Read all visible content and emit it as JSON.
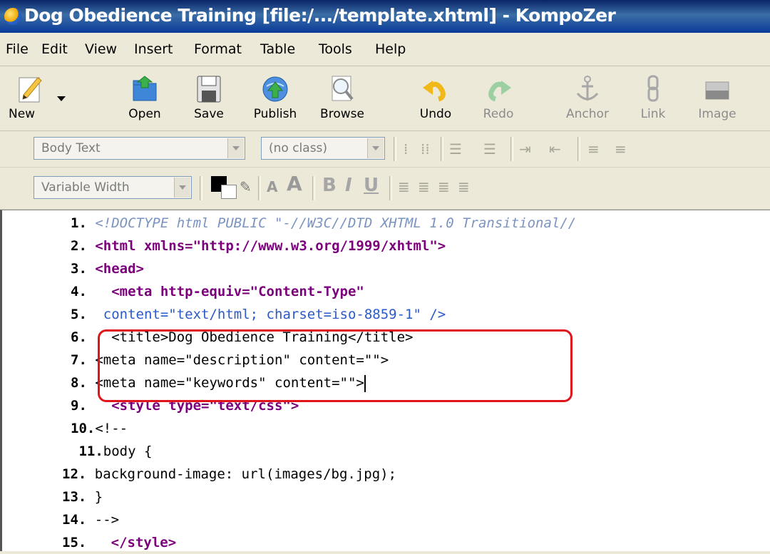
{
  "window": {
    "title": "Dog Obedience Training [file:/.../template.xhtml] - KompoZer"
  },
  "menu": {
    "items": [
      {
        "label": "File"
      },
      {
        "label": "Edit"
      },
      {
        "label": "View"
      },
      {
        "label": "Insert"
      },
      {
        "label": "Format"
      },
      {
        "label": "Table"
      },
      {
        "label": "Tools"
      },
      {
        "label": "Help"
      }
    ]
  },
  "toolbar": {
    "buttons": [
      {
        "label": "New",
        "icon": "new-page-pencil-icon",
        "enabled": true
      },
      {
        "label": "Open",
        "icon": "open-folder-icon",
        "enabled": true
      },
      {
        "label": "Save",
        "icon": "floppy-disk-icon",
        "enabled": true
      },
      {
        "label": "Publish",
        "icon": "globe-upload-icon",
        "enabled": true
      },
      {
        "label": "Browse",
        "icon": "magnifier-page-icon",
        "enabled": true
      },
      {
        "label": "Undo",
        "icon": "undo-arrow-icon",
        "enabled": true
      },
      {
        "label": "Redo",
        "icon": "redo-arrow-icon",
        "enabled": false
      },
      {
        "label": "Anchor",
        "icon": "anchor-icon",
        "enabled": false
      },
      {
        "label": "Link",
        "icon": "chain-link-icon",
        "enabled": false
      },
      {
        "label": "Image",
        "icon": "image-icon",
        "enabled": false
      }
    ]
  },
  "format_toolbar": {
    "paragraph_format": "Body Text",
    "class": "(no class)",
    "font": "Variable Width"
  },
  "editor": {
    "lines": [
      {
        "num": "1.",
        "text": "<!DOCTYPE html PUBLIC \"-//W3C//DTD XHTML 1.0 Transitional//"
      },
      {
        "num": "2.",
        "text": "<html xmlns=\"http://www.w3.org/1999/xhtml\">"
      },
      {
        "num": "3.",
        "text": "<head>"
      },
      {
        "num": "4.",
        "text": "<meta http-equiv=\"Content-Type\""
      },
      {
        "num": "5.",
        "text": "content=\"text/html; charset=iso-8859-1\" />"
      },
      {
        "num": "6.",
        "text": "<title>Dog Obedience Training</title>"
      },
      {
        "num": "7.",
        "text": "<meta name=\"description\" content=\"\">"
      },
      {
        "num": "8.",
        "text": "<meta name=\"keywords\" content=\"\">"
      },
      {
        "num": "9.",
        "text": "<style type=\"text/css\">"
      },
      {
        "num": "10.",
        "text": "<!--"
      },
      {
        "num": "11.",
        "text": "body {"
      },
      {
        "num": "12.",
        "text": "background-image: url(images/bg.jpg);"
      },
      {
        "num": "13.",
        "text": "}"
      },
      {
        "num": "14.",
        "text": "-->"
      },
      {
        "num": "15.",
        "text": "</style>"
      }
    ]
  },
  "colors": {
    "highlight_border": "#e0151b",
    "tag": "#7b007b",
    "value": "#2a5ac8",
    "comment": "#7a93c0"
  }
}
